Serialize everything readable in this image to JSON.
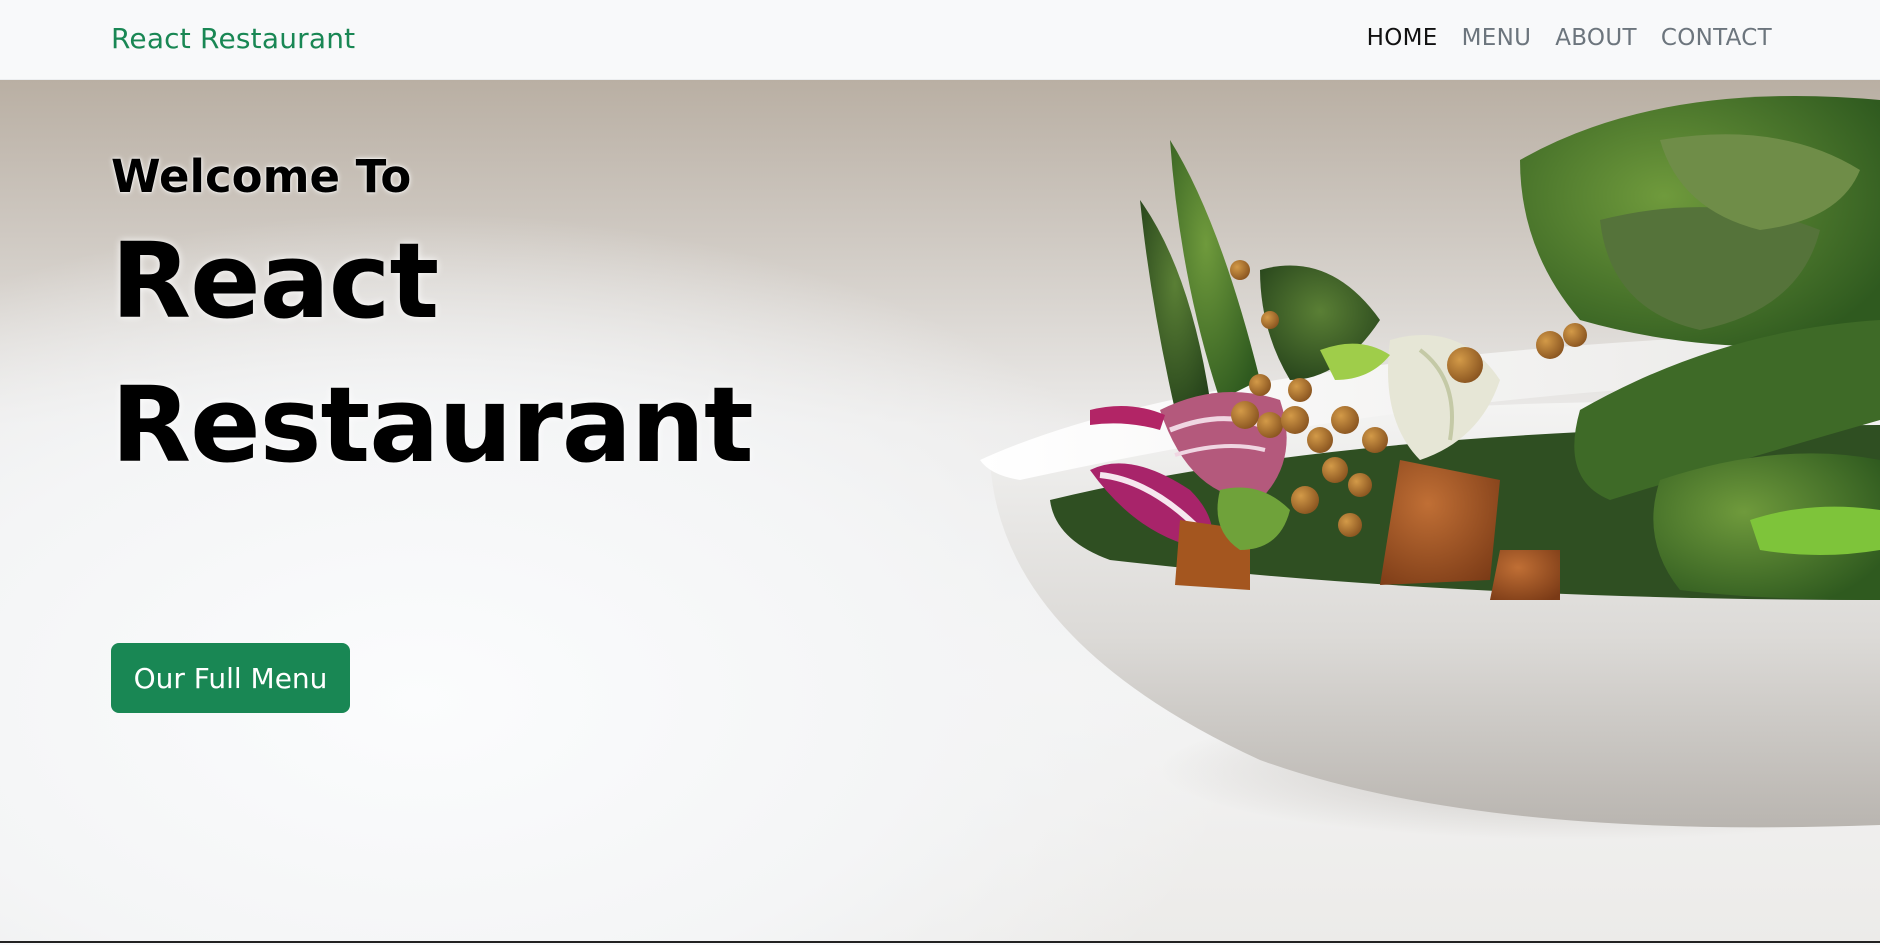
{
  "navbar": {
    "brand": "React Restaurant",
    "links": [
      {
        "label": "HOME",
        "active": true
      },
      {
        "label": "MENU",
        "active": false
      },
      {
        "label": "ABOUT",
        "active": false
      },
      {
        "label": "CONTACT",
        "active": false
      }
    ]
  },
  "hero": {
    "welcome": "Welcome To",
    "title_line1": "React",
    "title_line2": "Restaurant",
    "button_label": "Our Full Menu",
    "image_subject": "salad-bowl-image"
  },
  "colors": {
    "brand": "#198754",
    "nav_inactive": "#6c757d",
    "nav_active": "#111111"
  }
}
